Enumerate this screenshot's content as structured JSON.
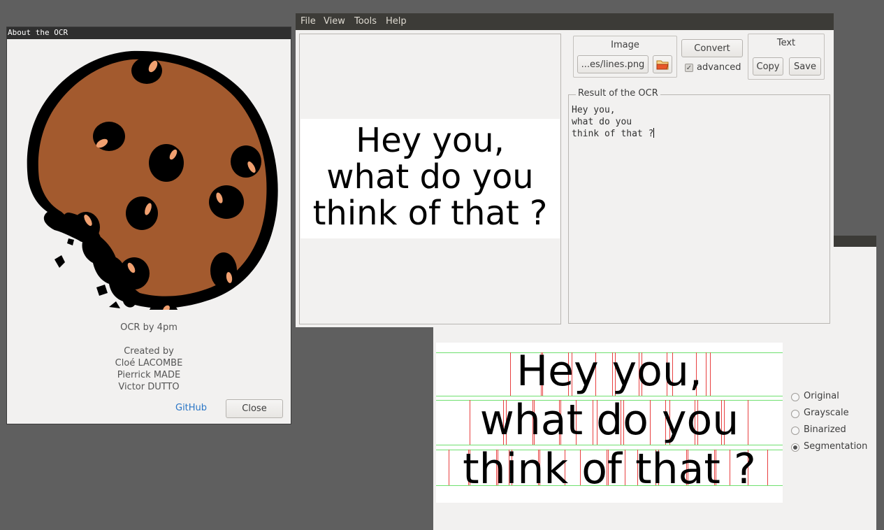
{
  "about": {
    "title": "About the OCR",
    "app_name": "OCR by 4pm",
    "created_by": "Created by",
    "authors": [
      "Cloé LACOMBE",
      "Pierrick MADE",
      "Victor DUTTO"
    ],
    "github": "GitHub",
    "close": "Close"
  },
  "main": {
    "menu": [
      "File",
      "View",
      "Tools",
      "Help"
    ],
    "preview_lines": [
      "Hey you,",
      "what do you",
      "think of that ?"
    ],
    "image_group": "Image",
    "image_file": "...es/lines.png",
    "convert": "Convert",
    "advanced": "advanced",
    "advanced_checked": true,
    "text_group": "Text",
    "copy": "Copy",
    "save": "Save",
    "result_label": "Result of the OCR",
    "result_lines": [
      "Hey you,",
      "what do you",
      "think of that ?"
    ]
  },
  "segmentation": {
    "lines": [
      "Hey you,",
      "what do you",
      "think of that ?"
    ],
    "options": [
      {
        "label": "Original",
        "selected": false
      },
      {
        "label": "Grayscale",
        "selected": false
      },
      {
        "label": "Binarized",
        "selected": false
      },
      {
        "label": "Segmentation",
        "selected": true
      }
    ]
  },
  "colors": {
    "desktop": "#5f5f5f",
    "window_bg": "#f2f1f0",
    "menubar": "#3c3b37",
    "cookie_dough": "#a35a2e",
    "chip_highlight": "#f0a070",
    "link": "#2a76c6",
    "line_guide": "#6fe06f",
    "char_guide": "#e84040"
  },
  "icons": {
    "open": "folder-open-icon",
    "check": "checkmark-icon",
    "logo": "cookie-logo"
  }
}
